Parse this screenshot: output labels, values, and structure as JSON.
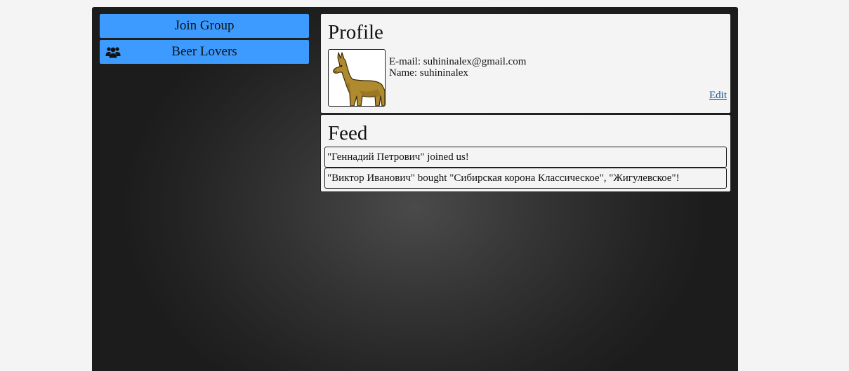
{
  "sidebar": {
    "join_group_label": "Join Group",
    "groups": [
      {
        "label": "Beer Lovers",
        "icon": "group-icon"
      }
    ]
  },
  "profile": {
    "title": "Profile",
    "email_line": "E-mail: suhininalex@gmail.com",
    "name_line": "Name: suhininalex",
    "edit_label": "Edit",
    "avatar_icon": "llama-avatar"
  },
  "feed": {
    "title": "Feed",
    "items": [
      "\"Геннадий Петрович\" joined us!",
      "\"Виктор Иванович\" bought \"Сибирская корона Классическое\", \"Жигулевское\"!"
    ]
  },
  "colors": {
    "button_blue": "#3d9bff",
    "panel_bg": "#f4f4f4",
    "link": "#1a4f8a",
    "app_bg_center": "#4a4a4a",
    "app_bg_edge": "#1c1c1c"
  }
}
